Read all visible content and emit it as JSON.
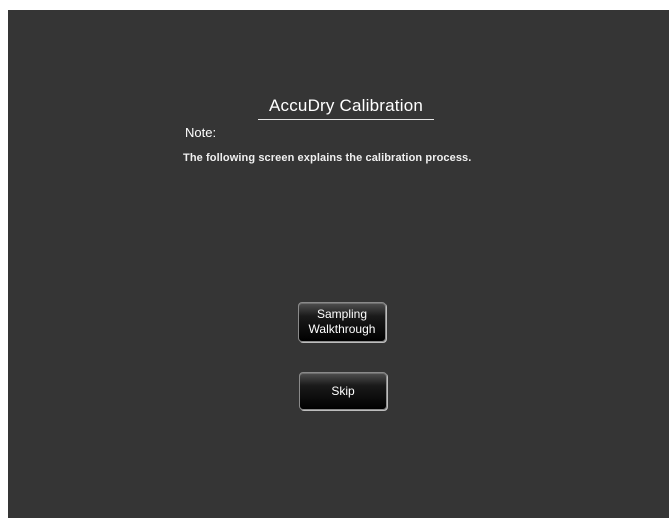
{
  "dialog": {
    "title": "AccuDry Calibration",
    "note_label": "Note:",
    "note_text": "The following screen explains the calibration process."
  },
  "buttons": {
    "sampling_line1": "Sampling",
    "sampling_line2": "Walkthrough",
    "skip": "Skip"
  },
  "colors": {
    "background": "#353535",
    "text": "#ffffff"
  }
}
